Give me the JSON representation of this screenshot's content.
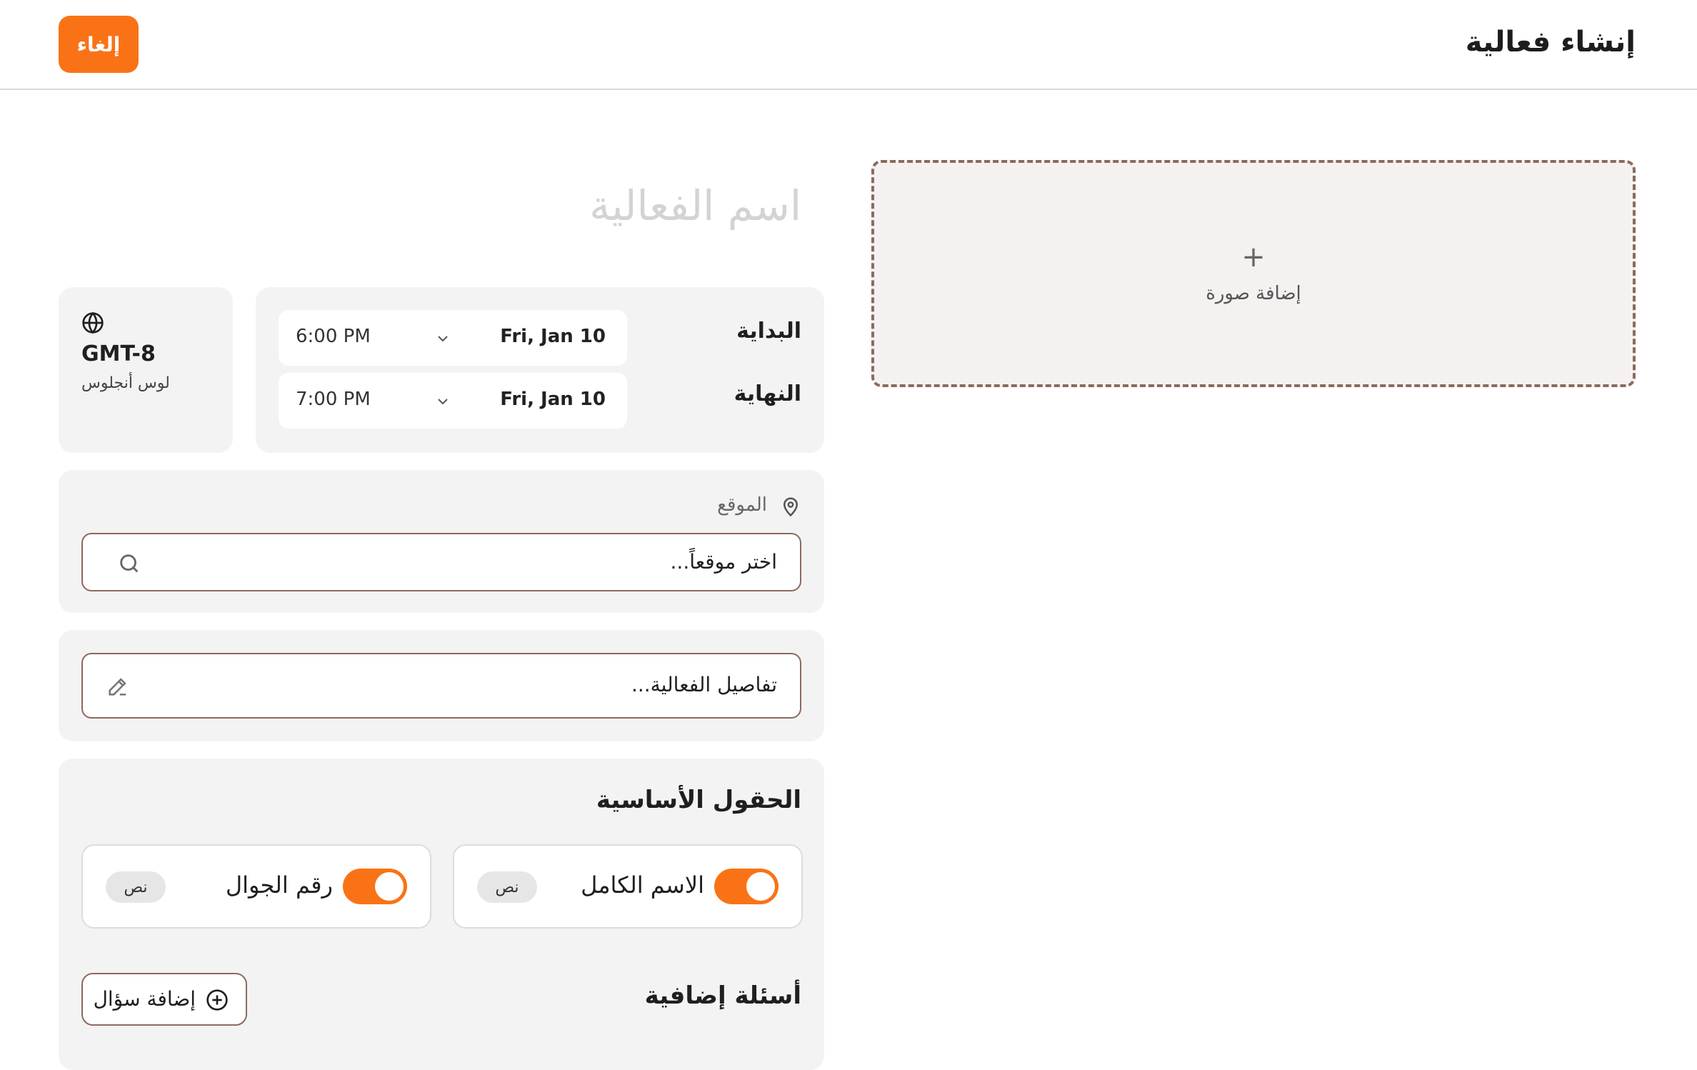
{
  "header": {
    "title": "إنشاء فعالية",
    "cancel_label": "إلغاء"
  },
  "image_upload": {
    "icon": "plus-icon",
    "label": "إضافة صورة"
  },
  "event": {
    "name_placeholder": "اسم الفعالية"
  },
  "timezone": {
    "icon": "globe-icon",
    "code": "GMT-8",
    "city": "لوس أنجلوس"
  },
  "schedule": {
    "start": {
      "label": "البداية",
      "time": "6:00 PM",
      "date": "Fri, Jan 10"
    },
    "end": {
      "label": "النهاية",
      "time": "7:00 PM",
      "date": "Fri, Jan 10"
    }
  },
  "location": {
    "icon": "map-pin-icon",
    "label": "الموقع",
    "placeholder": "اختر موقعاً..."
  },
  "description": {
    "placeholder": "تفاصيل الفعالية..."
  },
  "basic_fields": {
    "title": "الحقول الأساسية",
    "items": [
      {
        "label": "الاسم الكامل",
        "type": "نص",
        "enabled": true
      },
      {
        "label": "رقم الجوال",
        "type": "نص",
        "enabled": true
      }
    ]
  },
  "extra_questions": {
    "title": "أسئلة إضافية",
    "add_label": "إضافة سؤال"
  },
  "colors": {
    "accent": "#f97316",
    "border_brown": "#8c6a5c",
    "card_bg": "#f3f3f4"
  }
}
